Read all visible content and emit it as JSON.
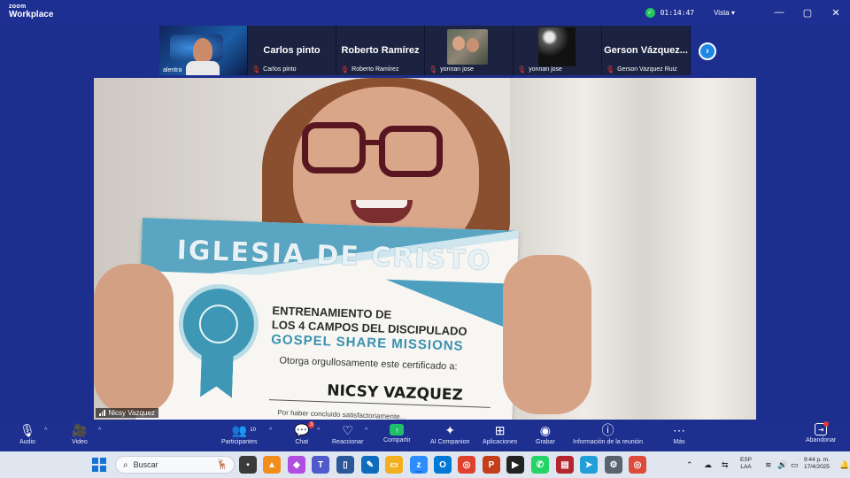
{
  "app": {
    "logo_small": "zoom",
    "logo_big": "Workplace",
    "timer": "01:14:47",
    "view_label": "Vista",
    "window_controls": {
      "minimize": "—",
      "maximize": "▢",
      "close": "✕"
    }
  },
  "participants_strip": {
    "tiles": [
      {
        "display_name": "",
        "label": "alentra",
        "has_video": true
      },
      {
        "display_name": "Carlos pinto",
        "label": "Carlos pinto",
        "has_video": false
      },
      {
        "display_name": "Roberto Ramírez",
        "label": "Roberto Ramírez",
        "has_video": false
      },
      {
        "display_name": "",
        "label": "yonnan jose",
        "has_video": true
      },
      {
        "display_name": "",
        "label": "yonnan jose",
        "has_video": true
      },
      {
        "display_name": "Gerson  Vázquez...",
        "label": "Gerson Vazquez Ruiz",
        "has_video": false
      }
    ],
    "next_icon": "›"
  },
  "main_video": {
    "speaker_label": "Nicsy Vazquez",
    "certificate": {
      "title": "IGLESIA DE CRISTO",
      "line1": "ENTRENAMIENTO DE",
      "line2": "LOS 4 CAMPOS DEL DISCIPULADO",
      "line3": "GOSPEL SHARE MISSIONS",
      "line4": "Otorga orgullosamente este certificado a:",
      "recipient": "NICSY VAZQUEZ",
      "line6": "Por haber concluido satisfactoriamente..."
    }
  },
  "toolbar": {
    "audio": "Audio",
    "video": "Video",
    "participants": "Participantes",
    "participants_count": "10",
    "chat": "Chat",
    "chat_badge": "3",
    "reactions": "Reaccionar",
    "share": "Compartir",
    "ai_companion": "AI Companion",
    "apps": "Aplicaciones",
    "record": "Grabar",
    "meeting_info": "Información de la reunión",
    "more": "Más",
    "leave": "Abandonar"
  },
  "taskbar": {
    "search_placeholder": "Buscar",
    "language_line1": "ESP",
    "language_line2": "LAA",
    "time": "9:44 p. m.",
    "date": "17/4/2025"
  },
  "colors": {
    "window_bg": "#1c2f8f",
    "accent_share": "#1fbf6a",
    "mic_off": "#e53935",
    "certificate_blue": "#3e98b5"
  }
}
